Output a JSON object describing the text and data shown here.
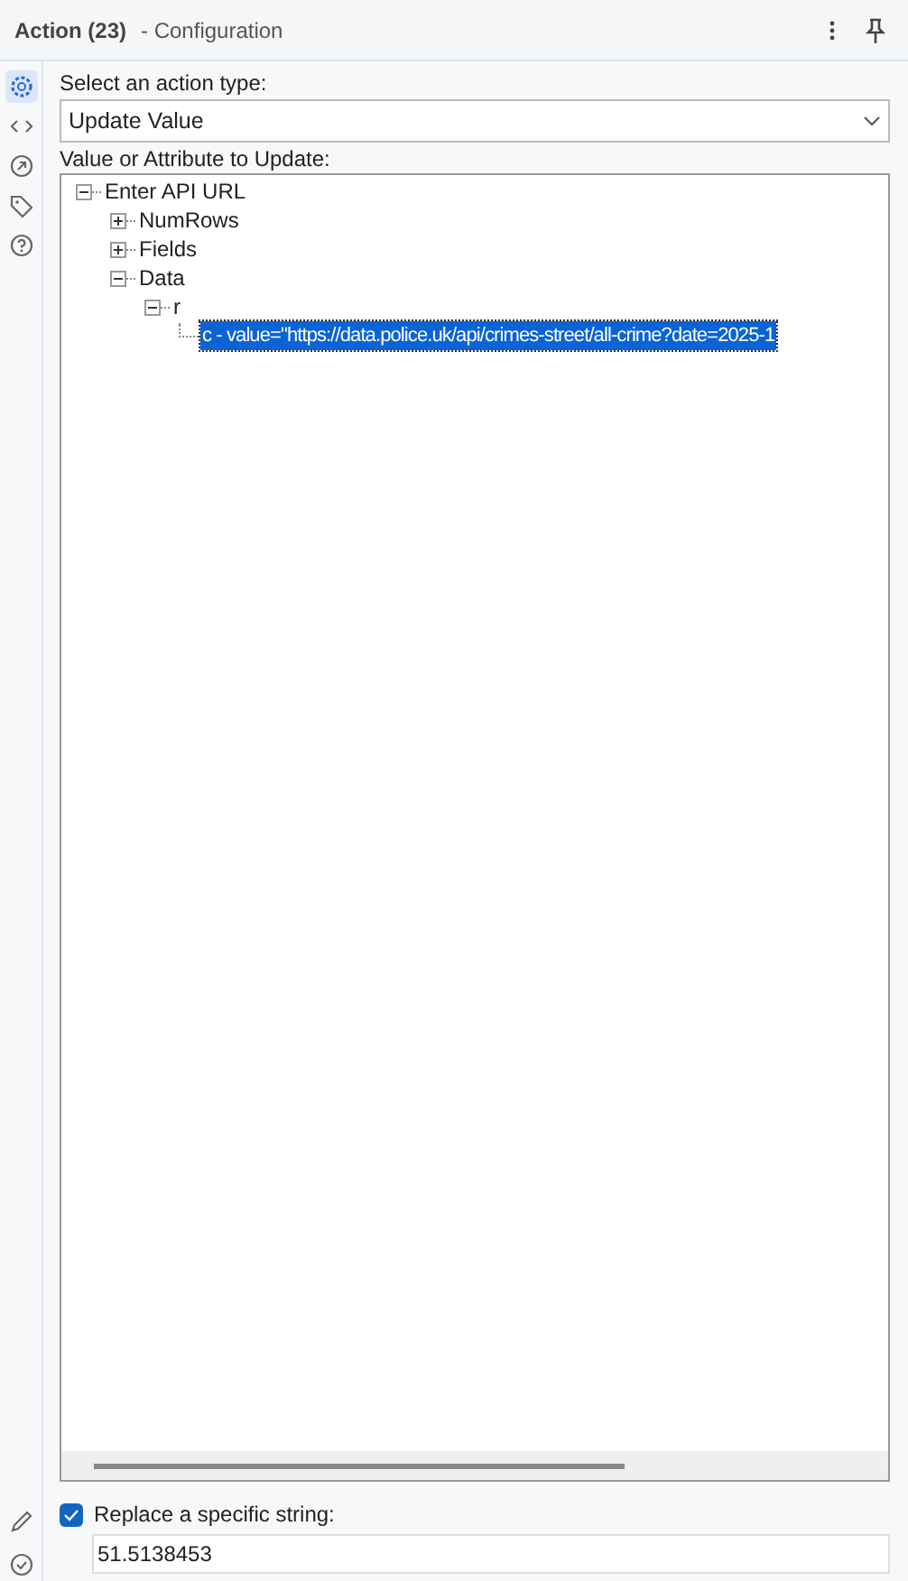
{
  "header": {
    "title": "Action (23)",
    "subtitle": "- Configuration"
  },
  "sidebar": {
    "items": [
      {
        "selected": true
      },
      {
        "selected": false
      },
      {
        "selected": false
      },
      {
        "selected": false
      },
      {
        "selected": false
      }
    ]
  },
  "action_type": {
    "label": "Select an action type:",
    "value": "Update Value"
  },
  "tree": {
    "label": "Value or Attribute to Update:",
    "items": [
      {
        "label": "Enter API URL",
        "expanded": true,
        "selected": false,
        "children": [
          {
            "label": "NumRows",
            "expanded": false,
            "selected": false
          },
          {
            "label": "Fields",
            "expanded": false,
            "selected": false
          },
          {
            "label": "Data",
            "expanded": true,
            "selected": false,
            "children": [
              {
                "label": "r",
                "expanded": true,
                "selected": false,
                "children": [
                  {
                    "label": "c - value=\"https://data.police.uk/api/crimes-street/all-crime?date=2025-1",
                    "selected": true
                  }
                ]
              }
            ]
          }
        ]
      }
    ]
  },
  "replace": {
    "label": "Replace a specific string:",
    "checked": true,
    "value": "51.5138453"
  }
}
